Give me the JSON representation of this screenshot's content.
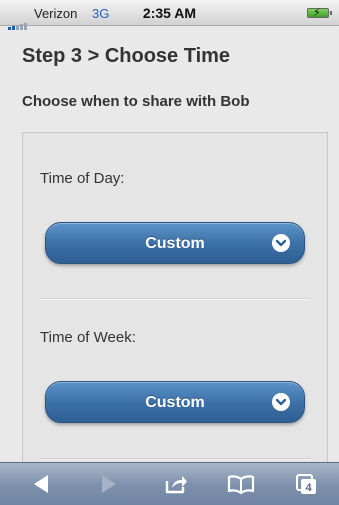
{
  "status_bar": {
    "carrier": "Verizon",
    "network": "3G",
    "time": "2:35 AM"
  },
  "page": {
    "title": "Step 3 > Choose Time",
    "subtitle": "Choose when to share with Bob"
  },
  "fields": [
    {
      "label": "Time of Day:",
      "value": "Custom"
    },
    {
      "label": "Time of Week:",
      "value": "Custom"
    }
  ],
  "toolbar": {
    "tabs_count": "4",
    "icons": [
      "back-icon",
      "forward-icon",
      "share-icon",
      "bookmarks-icon",
      "tabs-icon"
    ]
  },
  "colors": {
    "select_blue": "#3b6fa6",
    "toolbar_blue": "#7f92ad"
  }
}
